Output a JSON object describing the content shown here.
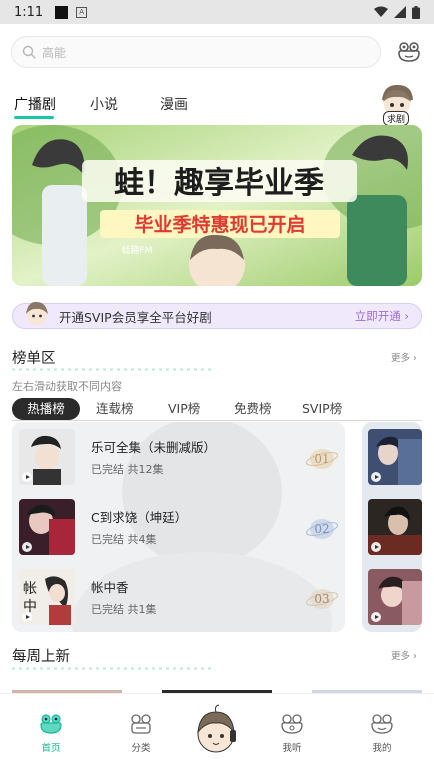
{
  "status_bar": {
    "time": "1:11",
    "a_indicator": "A"
  },
  "search": {
    "placeholder": "高能"
  },
  "tabs": [
    {
      "label": "广播剧",
      "active": true
    },
    {
      "label": "小说",
      "active": false
    },
    {
      "label": "漫画",
      "active": false
    }
  ],
  "request_tag": "求剧",
  "svip_bar": {
    "text": "开通SVIP会员享全平台好剧",
    "link": "立即开通"
  },
  "ranking": {
    "title": "榜单区",
    "more": "更多",
    "subtitle": "左右滑动获取不同内容",
    "tabs": [
      "热播榜",
      "连载榜",
      "VIP榜",
      "免费榜",
      "SVIP榜"
    ],
    "items": [
      {
        "rank": "01",
        "title": "乐可全集（未删减版）",
        "subtitle": "已完结 共12集"
      },
      {
        "rank": "02",
        "title": "C到求饶（坤廷）",
        "subtitle": "已完结 共4集"
      },
      {
        "rank": "03",
        "title": "帐中香",
        "subtitle": "已完结 共1集"
      }
    ]
  },
  "weekly": {
    "title": "每周上新",
    "more": "更多"
  },
  "bottom_nav": [
    {
      "label": "首页",
      "active": true
    },
    {
      "label": "分类",
      "active": false
    },
    {
      "label": "我听",
      "active": false
    },
    {
      "label": "我的",
      "active": false
    }
  ],
  "colors": {
    "accent": "#17c7a6",
    "svip_link": "#a06cd5",
    "svip_bg": "#efe9fb"
  }
}
